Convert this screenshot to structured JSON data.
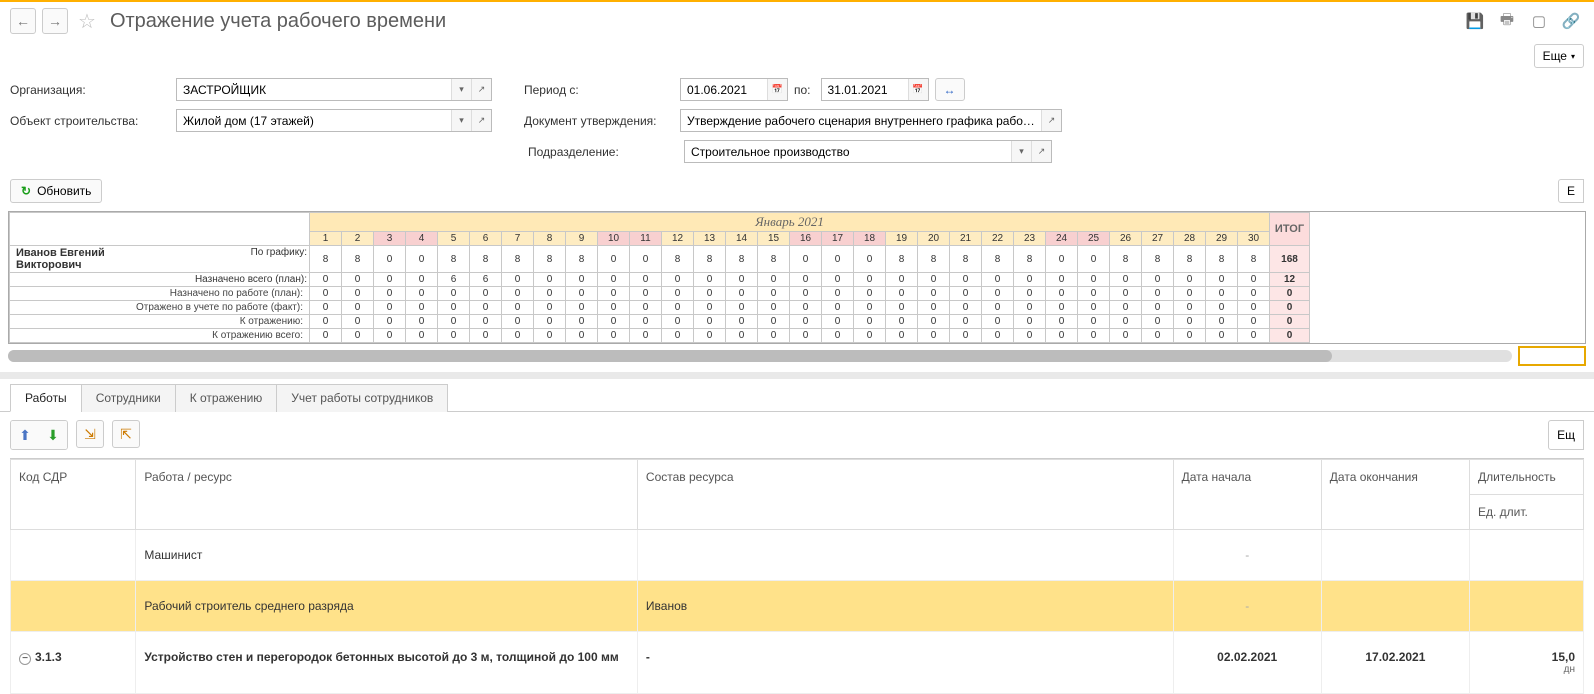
{
  "header": {
    "title": "Отражение учета рабочего времени",
    "more_label": "Еще"
  },
  "filters": {
    "org_label": "Организация:",
    "org_value": "ЗАСТРОЙЩИК",
    "obj_label": "Объект строительства:",
    "obj_value": "Жилой дом (17 этажей)",
    "period_from_label": "Период с:",
    "period_from": "01.06.2021",
    "period_to_label": "по:",
    "period_to": "31.01.2021",
    "doc_label": "Документ утверждения:",
    "doc_value": "Утверждение рабочего сценария внутреннего графика работ ...",
    "dept_label": "Подразделение:",
    "dept_value": "Строительное производство",
    "refresh_label": "Обновить",
    "more2_label": "Е"
  },
  "grid": {
    "month_title": "Январь 2021",
    "itog_label": "ИТОГ",
    "days": [
      "1",
      "2",
      "3",
      "4",
      "5",
      "6",
      "7",
      "8",
      "9",
      "10",
      "11",
      "12",
      "13",
      "14",
      "15",
      "16",
      "17",
      "18",
      "19",
      "20",
      "21",
      "22",
      "23",
      "24",
      "25",
      "26",
      "27",
      "28",
      "29",
      "30"
    ],
    "weekends": [
      3,
      4,
      10,
      11,
      16,
      17,
      18,
      24,
      25
    ],
    "employee": "Иванов Евгений Викторович",
    "rows": [
      {
        "label": "По графику:",
        "values": [
          8,
          8,
          0,
          0,
          8,
          8,
          8,
          8,
          8,
          0,
          0,
          8,
          8,
          8,
          8,
          0,
          0,
          0,
          8,
          8,
          8,
          8,
          8,
          0,
          0,
          8,
          8,
          8,
          8,
          8
        ],
        "itog": 168
      },
      {
        "label": "Назначено всего (план):",
        "values": [
          0,
          0,
          0,
          0,
          6,
          6,
          0,
          0,
          0,
          0,
          0,
          0,
          0,
          0,
          0,
          0,
          0,
          0,
          0,
          0,
          0,
          0,
          0,
          0,
          0,
          0,
          0,
          0,
          0,
          0
        ],
        "itog": 12
      },
      {
        "label": "Назначено по работе (план):",
        "values": [
          0,
          0,
          0,
          0,
          0,
          0,
          0,
          0,
          0,
          0,
          0,
          0,
          0,
          0,
          0,
          0,
          0,
          0,
          0,
          0,
          0,
          0,
          0,
          0,
          0,
          0,
          0,
          0,
          0,
          0
        ],
        "itog": 0
      },
      {
        "label": "Отражено в учете по работе (факт):",
        "values": [
          0,
          0,
          0,
          0,
          0,
          0,
          0,
          0,
          0,
          0,
          0,
          0,
          0,
          0,
          0,
          0,
          0,
          0,
          0,
          0,
          0,
          0,
          0,
          0,
          0,
          0,
          0,
          0,
          0,
          0
        ],
        "itog": 0
      },
      {
        "label": "К отражению:",
        "values": [
          0,
          0,
          0,
          0,
          0,
          0,
          0,
          0,
          0,
          0,
          0,
          0,
          0,
          0,
          0,
          0,
          0,
          0,
          0,
          0,
          0,
          0,
          0,
          0,
          0,
          0,
          0,
          0,
          0,
          0
        ],
        "itog": 0
      },
      {
        "label": "К отражению всего:",
        "values": [
          0,
          0,
          0,
          0,
          0,
          0,
          0,
          0,
          0,
          0,
          0,
          0,
          0,
          0,
          0,
          0,
          0,
          0,
          0,
          0,
          0,
          0,
          0,
          0,
          0,
          0,
          0,
          0,
          0,
          0
        ],
        "itog": 0
      }
    ]
  },
  "tabs": {
    "items": [
      {
        "label": "Работы",
        "active": true
      },
      {
        "label": "Сотрудники",
        "active": false
      },
      {
        "label": "К отражению",
        "active": false
      },
      {
        "label": "Учет работы сотрудников",
        "active": false
      }
    ],
    "more_label": "Ещ"
  },
  "lower": {
    "headers": {
      "code": "Код СДР",
      "work": "Работа / ресурс",
      "resource": "Состав ресурса",
      "date_start": "Дата начала",
      "date_end": "Дата окончания",
      "duration": "Длительность",
      "unit": "Ед. длит."
    },
    "rows": [
      {
        "code": "",
        "work": "Машинист",
        "resource": "",
        "date_start": "-",
        "date_end": "",
        "duration": "",
        "unit": "",
        "highlight": false,
        "bold": false
      },
      {
        "code": "",
        "work": "Рабочий строитель среднего разряда",
        "resource": "Иванов",
        "date_start": "-",
        "date_end": "",
        "duration": "",
        "unit": "",
        "highlight": true,
        "bold": false
      },
      {
        "code": "3.1.3",
        "work": "Устройство стен и перегородок бетонных высотой до 3 м, толщиной до 100 мм",
        "resource": "-",
        "date_start": "02.02.2021",
        "date_end": "17.02.2021",
        "duration": "15,0",
        "unit": "дн",
        "highlight": false,
        "bold": true,
        "tree": true
      }
    ]
  }
}
